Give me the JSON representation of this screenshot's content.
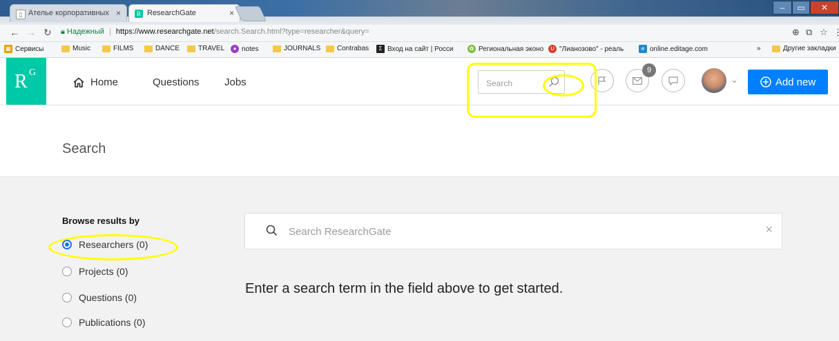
{
  "browser": {
    "tabs": [
      {
        "label": "Ателье корпоративных",
        "active": false
      },
      {
        "label": "ResearchGate",
        "active": true
      }
    ],
    "secure_label": "Надежный",
    "url_host": "https://www.researchgate.net",
    "url_path": "/search.Search.html?type=researcher&query=",
    "bookmarks": [
      "Сервисы",
      "Music",
      "FILMS",
      "DANCE",
      "TRAVEL",
      "notes",
      "JOURNALS",
      "Contrabas",
      "Вход на сайт | Росси",
      "Региональная эконо",
      "\"Лианозово\" - реаль",
      "online.editage.com"
    ],
    "bookmarks_overflow": "»",
    "other_bookmarks": "Другие закладки"
  },
  "header": {
    "logo": {
      "r": "R",
      "g": "G"
    },
    "nav": [
      "Home",
      "Questions",
      "Jobs"
    ],
    "search_placeholder": "Search",
    "messages_badge": "9",
    "add_new_label": "Add new"
  },
  "page": {
    "title": "Search",
    "browse_title": "Browse results by",
    "filters": [
      {
        "label": "Researchers (0)",
        "checked": true
      },
      {
        "label": "Projects (0)",
        "checked": false
      },
      {
        "label": "Questions (0)",
        "checked": false
      },
      {
        "label": "Publications (0)",
        "checked": false
      }
    ],
    "search_placeholder": "Search ResearchGate",
    "clear_symbol": "×",
    "hint": "Enter a search term in the field above to get started."
  },
  "colors": {
    "brand": "#00c9a7",
    "primary": "#0080ff",
    "annotation": "#ffff00"
  }
}
